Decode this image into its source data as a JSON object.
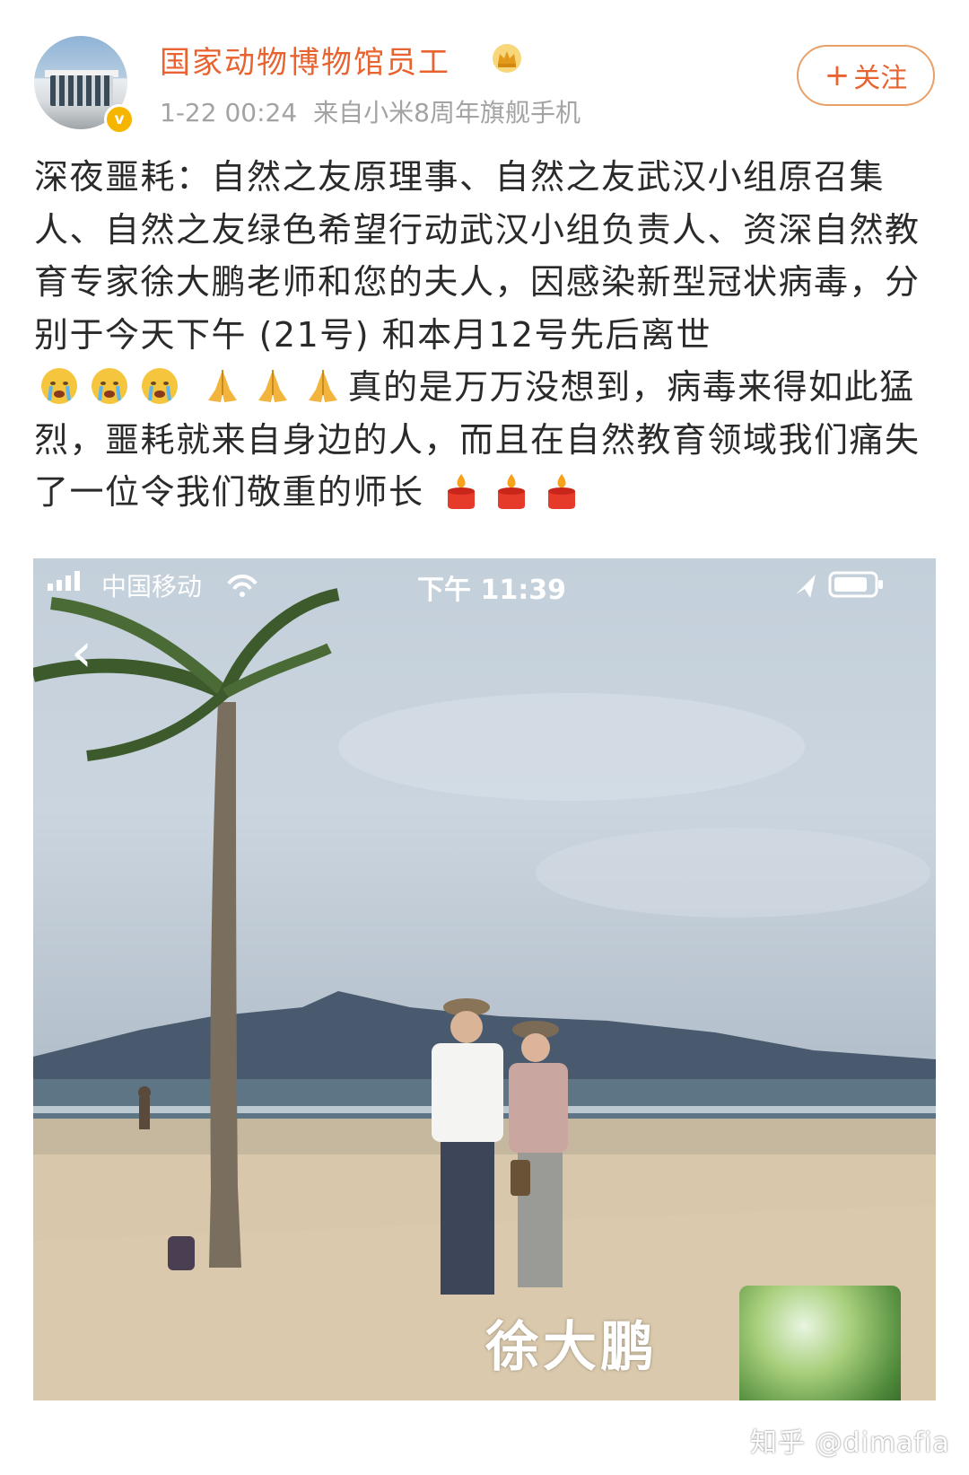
{
  "post": {
    "username": "国家动物博物馆员工",
    "time": "1-22 00:24",
    "source": "来自小米8周年旗舰手机",
    "follow_label": "关注",
    "text_parts": [
      "深夜噩耗：自然之友原理事、自然之友武汉小组原召集人、自然之友绿色希望行动武汉小组负责人、资深自然教育专家徐大鹏老师和您的夫人，因感染新型冠状病毒，分别于今天下午 (21号) 和本月12号先后离世",
      "真的是万万没想到，病毒来得如此猛烈，噩耗就来自身边的人，而且在自然教育领域我们痛失了一位令我们敬重的师长"
    ],
    "emojis_after_first": [
      "crying-face",
      "crying-face",
      "crying-face",
      "folded-hands",
      "folded-hands",
      "folded-hands"
    ],
    "emojis_after_second": [
      "candle",
      "candle",
      "candle"
    ]
  },
  "photo": {
    "status_carrier": "中国移动",
    "status_time": "下午 11:39",
    "caption_name": "徐大鹏"
  },
  "watermark": "知乎 @dimafia",
  "colors": {
    "username": "#e8632f",
    "meta": "#a3a3a3",
    "text": "#2a2a2a"
  }
}
